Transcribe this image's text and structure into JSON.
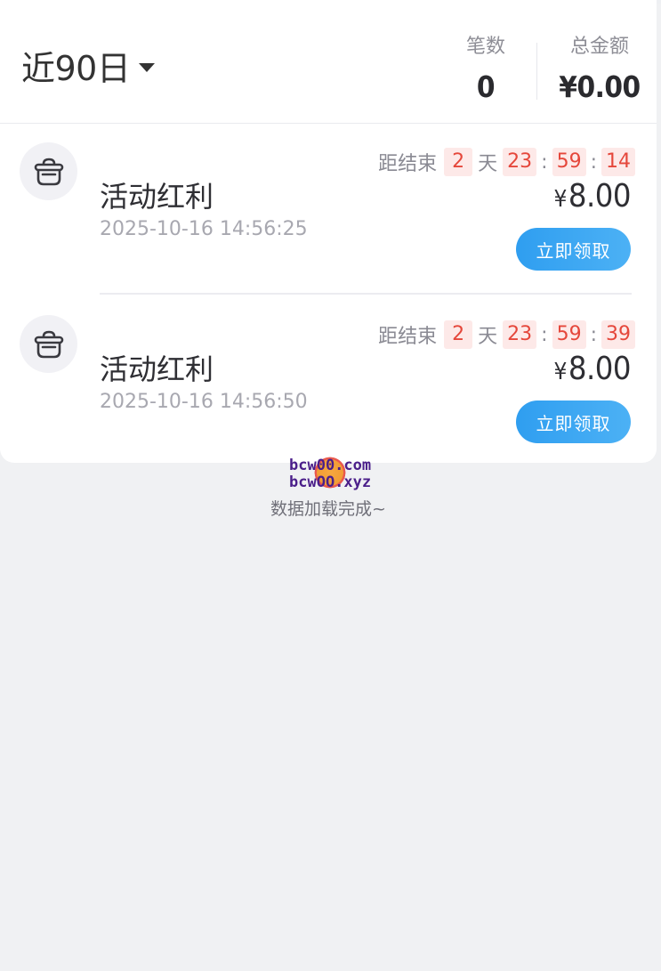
{
  "header": {
    "period_label": "近90日",
    "count_label": "笔数",
    "count_value": "0",
    "amount_label": "总金额",
    "amount_value": "¥0.00"
  },
  "items": [
    {
      "title": "活动红利",
      "time": "2025-10-16 14:56:25",
      "countdown": {
        "prefix": "距结束",
        "days": "2",
        "day_unit": "天",
        "hours": "23",
        "minutes": "59",
        "seconds": "14"
      },
      "currency": "¥",
      "amount": "8.00",
      "button_label": "立即领取"
    },
    {
      "title": "活动红利",
      "time": "2025-10-16 14:56:50",
      "countdown": {
        "prefix": "距结束",
        "days": "2",
        "day_unit": "天",
        "hours": "23",
        "minutes": "59",
        "seconds": "39"
      },
      "currency": "¥",
      "amount": "8.00",
      "button_label": "立即领取"
    }
  ],
  "footer": {
    "watermark_line1": "bcw00.com",
    "watermark_line2": "bcwOO.xyz",
    "loaded_text": "数据加载完成~"
  },
  "colors": {
    "accent": "#2f9ef0",
    "countdown_bg": "#fde9e8",
    "countdown_text": "#e5473b",
    "page_bg": "#f0f1f3"
  }
}
